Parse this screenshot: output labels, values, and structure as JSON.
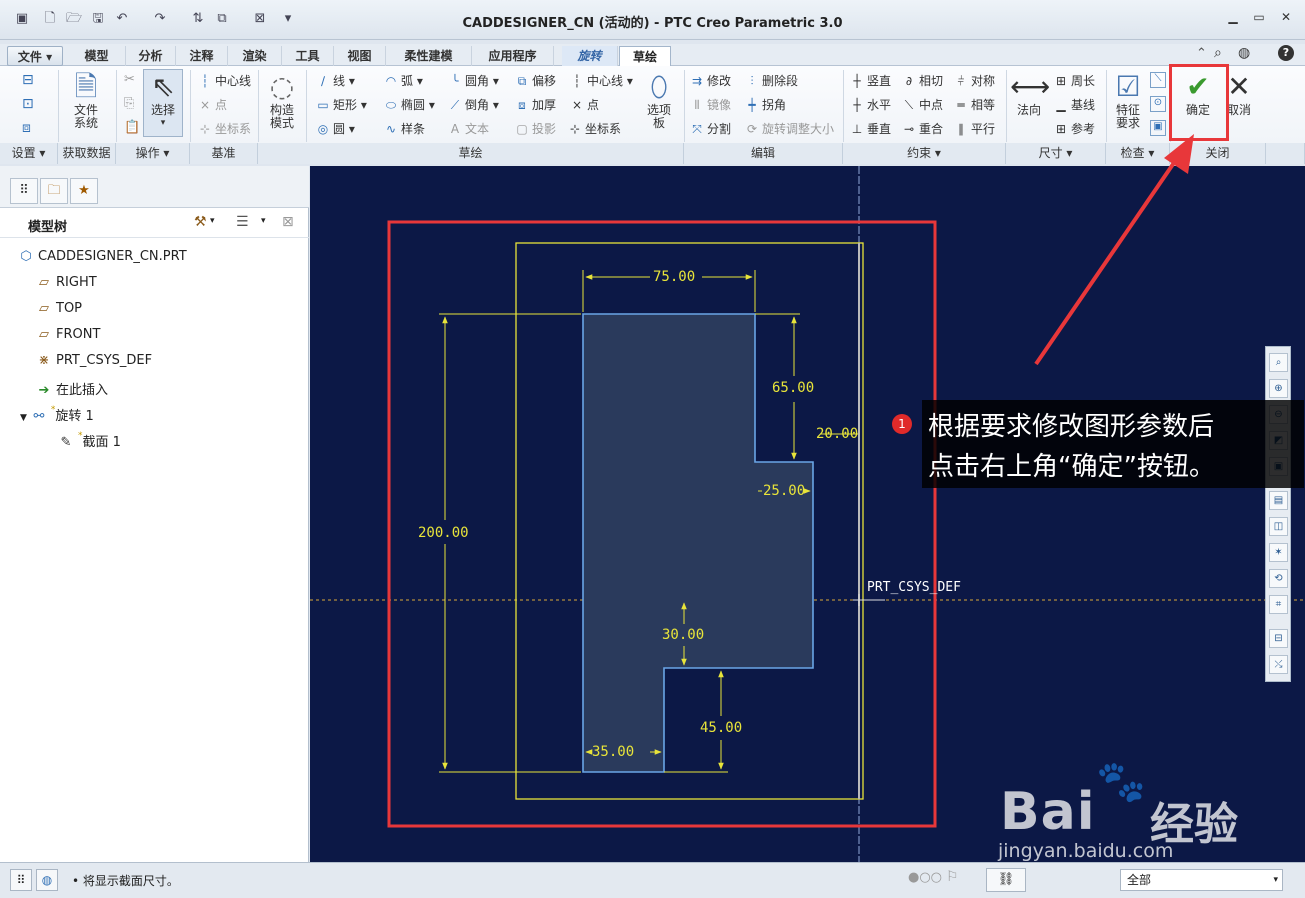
{
  "window": {
    "title": "CADDESIGNER_CN (活动的) - PTC Creo Parametric 3.0"
  },
  "tabs": [
    {
      "label": "文件"
    },
    {
      "label": "模型"
    },
    {
      "label": "分析"
    },
    {
      "label": "注释"
    },
    {
      "label": "渲染"
    },
    {
      "label": "工具"
    },
    {
      "label": "视图"
    },
    {
      "label": "柔性建模"
    },
    {
      "label": "应用程序"
    },
    {
      "label": "旋转"
    },
    {
      "label": "草绘"
    }
  ],
  "ribbon": {
    "file_system": "文件\n系统",
    "select": "选择",
    "centerline1": "中心线",
    "point1": "点",
    "csys1": "坐标系",
    "construct_mode": "构造\n模式",
    "line": "线",
    "rectangle": "矩形",
    "circle": "圆",
    "arc": "弧",
    "ellipse": "椭圆",
    "spline": "样条",
    "fillet": "圆角",
    "chamfer": "倒角",
    "text": "文本",
    "offset": "偏移",
    "thicken": "加厚",
    "project": "投影",
    "centerline2": "中心线",
    "point2": "点",
    "csys2": "坐标系",
    "palette": "选项\n板",
    "modify": "修改",
    "delete_segment": "删除段",
    "mirror": "镜像",
    "corner": "拐角",
    "divide": "分割",
    "rotate_resize": "旋转调整大小",
    "vertical": "竖直",
    "horizontal": "水平",
    "perpendicular": "垂直",
    "tangent": "相切",
    "midpoint": "中点",
    "coincident": "重合",
    "symmetric": "对称",
    "equal": "相等",
    "parallel": "平行",
    "normal": "法向",
    "perimeter": "周长",
    "baseline": "基线",
    "reference": "参考",
    "feature_req": "特征\n要求",
    "ok": "确定",
    "cancel": "取消"
  },
  "groups": [
    {
      "label": "设置"
    },
    {
      "label": "获取数据"
    },
    {
      "label": "操作"
    },
    {
      "label": "基准"
    },
    {
      "label": "草绘"
    },
    {
      "label": "编辑"
    },
    {
      "label": "约束"
    },
    {
      "label": "尺寸"
    },
    {
      "label": "检查"
    },
    {
      "label": "关闭"
    }
  ],
  "model_tree": {
    "header": "模型树",
    "items": [
      {
        "label": "CADDESIGNER_CN.PRT",
        "icon": "part-icon"
      },
      {
        "label": "RIGHT",
        "icon": "datum-plane-icon"
      },
      {
        "label": "TOP",
        "icon": "datum-plane-icon"
      },
      {
        "label": "FRONT",
        "icon": "datum-plane-icon"
      },
      {
        "label": "PRT_CSYS_DEF",
        "icon": "csys-icon"
      },
      {
        "label": "在此插入",
        "icon": "insert-arrow-icon"
      },
      {
        "label": "旋转 1",
        "icon": "revolve-icon"
      },
      {
        "label": "截面 1",
        "icon": "sketch-icon"
      }
    ]
  },
  "sketch": {
    "dims": {
      "d75": "75.00",
      "d65": "65.00",
      "d20": "20.00",
      "d25": "25.00",
      "d200": "200.00",
      "d30": "30.00",
      "d45": "45.00",
      "d35": "35.00"
    },
    "csys_label": "PRT_CSYS_DEF",
    "colors": {
      "background": "#0c1846",
      "dimension": "#e8e43a",
      "geometry": "#6aa5e6",
      "highlight_box": "#e8373a"
    }
  },
  "annotation": {
    "number": "1",
    "line1": "根据要求修改图形参数后",
    "line2": "点击右上角“确定”按钮。"
  },
  "statusbar": {
    "message": "将显示截面尺寸。",
    "filter": "全部"
  },
  "watermark": {
    "brand": "Bai",
    "brand2": "经验",
    "url": "jingyan.baidu.com"
  }
}
